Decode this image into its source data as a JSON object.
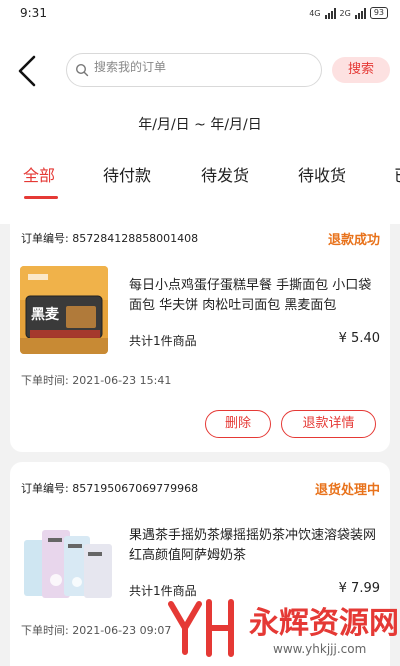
{
  "statusbar": {
    "time": "9:31",
    "network1": "4G",
    "network2": "2G",
    "battery": "93"
  },
  "header": {
    "search_placeholder": "搜索我的订单",
    "search_button": "搜索",
    "date_range": "年/月/日 ~ 年/月/日"
  },
  "tabs": [
    {
      "label": "全部",
      "active": true
    },
    {
      "label": "待付款"
    },
    {
      "label": "待发货"
    },
    {
      "label": "待收货"
    },
    {
      "label": "已"
    }
  ],
  "orders": [
    {
      "order_no": "订单编号: 857284128858001408",
      "status": "退款成功",
      "product_name": "每日小点鸡蛋仔蛋糕早餐 手撕面包 小口袋面包 华夫饼 肉松吐司面包 黑麦面包",
      "thumb_text": "黑麦",
      "total": "共计1件商品",
      "price": "¥ 5.40",
      "order_time": "下单时间: 2021-06-23 15:41",
      "buttons": [
        "删除",
        "退款详情"
      ]
    },
    {
      "order_no": "订单编号: 857195067069779968",
      "status": "退货处理中",
      "product_name": "果遇茶手摇奶茶爆摇摇奶茶冲饮速溶袋装网红高颜值阿萨姆奶茶",
      "total": "共计1件商品",
      "price": "¥ 7.99",
      "order_time": "下单时间: 2021-06-23 09:07"
    }
  ],
  "watermark": {
    "brand": "永辉资源网",
    "url": "www.yhkjjj.com"
  }
}
